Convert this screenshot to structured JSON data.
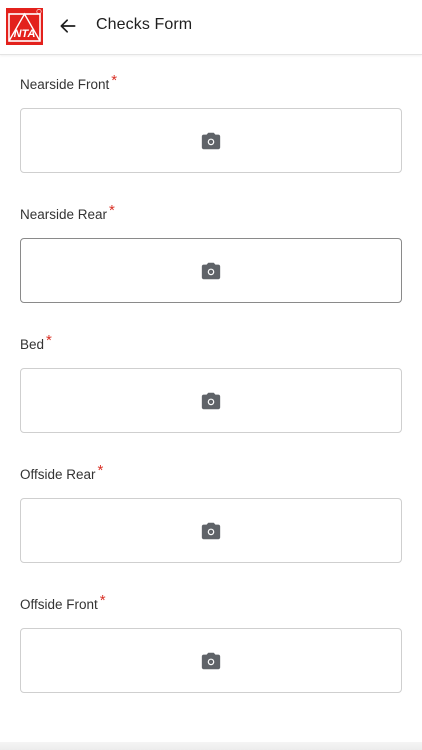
{
  "header": {
    "title": "Checks Form",
    "logo_text": "NTA",
    "back_icon": "arrow-left-icon"
  },
  "form": {
    "required_mark": "*",
    "camera_icon": "camera-icon",
    "fields": [
      {
        "label": "Nearside Front"
      },
      {
        "label": "Nearside Rear"
      },
      {
        "label": "Bed"
      },
      {
        "label": "Offside Rear"
      },
      {
        "label": "Offside Front"
      }
    ]
  },
  "colors": {
    "brand_red": "#e3211c",
    "required": "#d93025",
    "icon": "#5f6368"
  }
}
